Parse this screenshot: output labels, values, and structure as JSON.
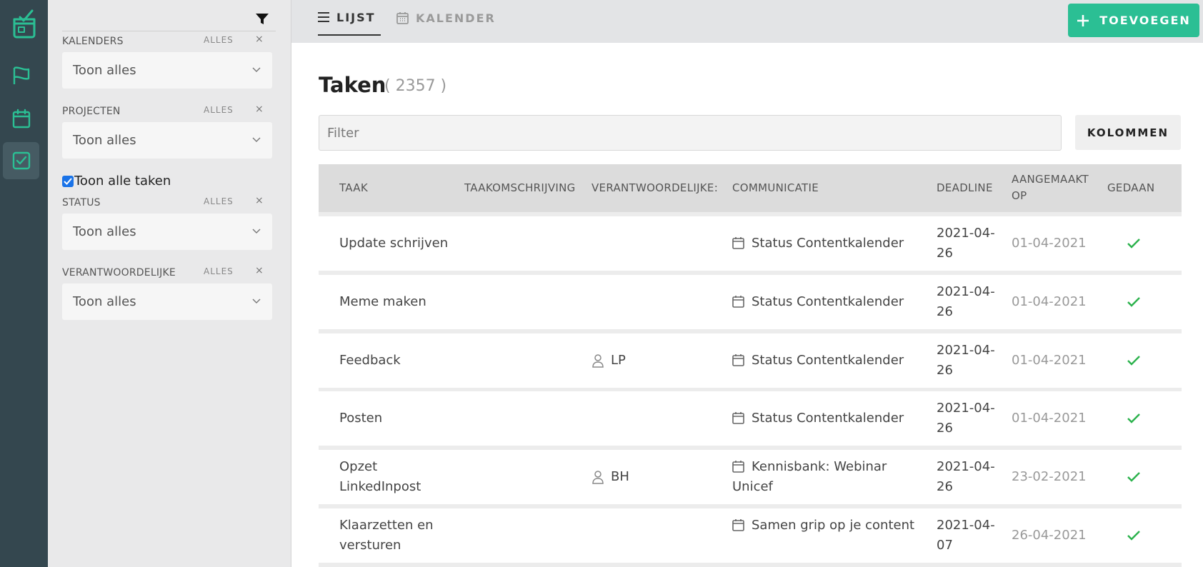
{
  "rail": {
    "icons": [
      "app-logo-icon",
      "flag-icon",
      "calendar-icon",
      "checkbox-tasks-icon"
    ],
    "active": "checkbox-tasks-icon",
    "accent": "#2bbf94"
  },
  "filters": {
    "groups": [
      {
        "label": "KALENDERS",
        "alles": "ALLES",
        "clear": "×",
        "value": "Toon alles"
      },
      {
        "label": "PROJECTEN",
        "alles": "ALLES",
        "clear": "×",
        "value": "Toon alles"
      },
      {
        "label": "STATUS",
        "alles": "ALLES",
        "clear": "×",
        "value": "Toon alles"
      },
      {
        "label": "VERANTWOORDELIJKE",
        "alles": "ALLES",
        "clear": "×",
        "value": "Toon alles"
      }
    ],
    "show_all_tasks": {
      "label": "Toon alle taken",
      "checked": true
    }
  },
  "tabs": {
    "lijst": "LIJST",
    "kalender": "KALENDER",
    "active": "lijst"
  },
  "add_button": "TOEVOEGEN",
  "page": {
    "title": "Taken",
    "count": "( 2357 )"
  },
  "filter_input": {
    "placeholder": "Filter",
    "value": ""
  },
  "columns_button": "KOLOMMEN",
  "table": {
    "headers": {
      "taak": "TAAK",
      "omschrijving": "TAAKOMSCHRIJVING",
      "verantwoordelijke": "VERANTWOORDELIJKE:",
      "communicatie": "COMMUNICATIE",
      "deadline": "DEADLINE",
      "aangemaakt_1": "AANGEMAAKT",
      "aangemaakt_2": "OP",
      "gedaan": "GEDAAN"
    },
    "rows": [
      {
        "taak_1": "Update schrijven",
        "taak_2": "",
        "owner": "",
        "comm_1": "Status Contentkalender",
        "comm_2": "",
        "deadline_1": "2021-04-",
        "deadline_2": "26",
        "created": "01-04-2021",
        "done": true
      },
      {
        "taak_1": "Meme maken",
        "taak_2": "",
        "owner": "",
        "comm_1": "Status Contentkalender",
        "comm_2": "",
        "deadline_1": "2021-04-",
        "deadline_2": "26",
        "created": "01-04-2021",
        "done": true
      },
      {
        "taak_1": "Feedback",
        "taak_2": "",
        "owner": "LP",
        "comm_1": "Status Contentkalender",
        "comm_2": "",
        "deadline_1": "2021-04-",
        "deadline_2": "26",
        "created": "01-04-2021",
        "done": true
      },
      {
        "taak_1": "Posten",
        "taak_2": "",
        "owner": "",
        "comm_1": "Status Contentkalender",
        "comm_2": "",
        "deadline_1": "2021-04-",
        "deadline_2": "26",
        "created": "01-04-2021",
        "done": true
      },
      {
        "taak_1": "Opzet",
        "taak_2": "LinkedInpost",
        "owner": "BH",
        "comm_1": "Kennisbank: Webinar",
        "comm_2": "Unicef",
        "deadline_1": "2021-04-",
        "deadline_2": "26",
        "created": "23-02-2021",
        "done": true
      },
      {
        "taak_1": "Klaarzetten en",
        "taak_2": "versturen",
        "owner": "",
        "comm_1": "Samen grip op je content",
        "comm_2": "",
        "deadline_1": "2021-04-",
        "deadline_2": "07",
        "created": "26-04-2021",
        "done": true
      }
    ]
  }
}
